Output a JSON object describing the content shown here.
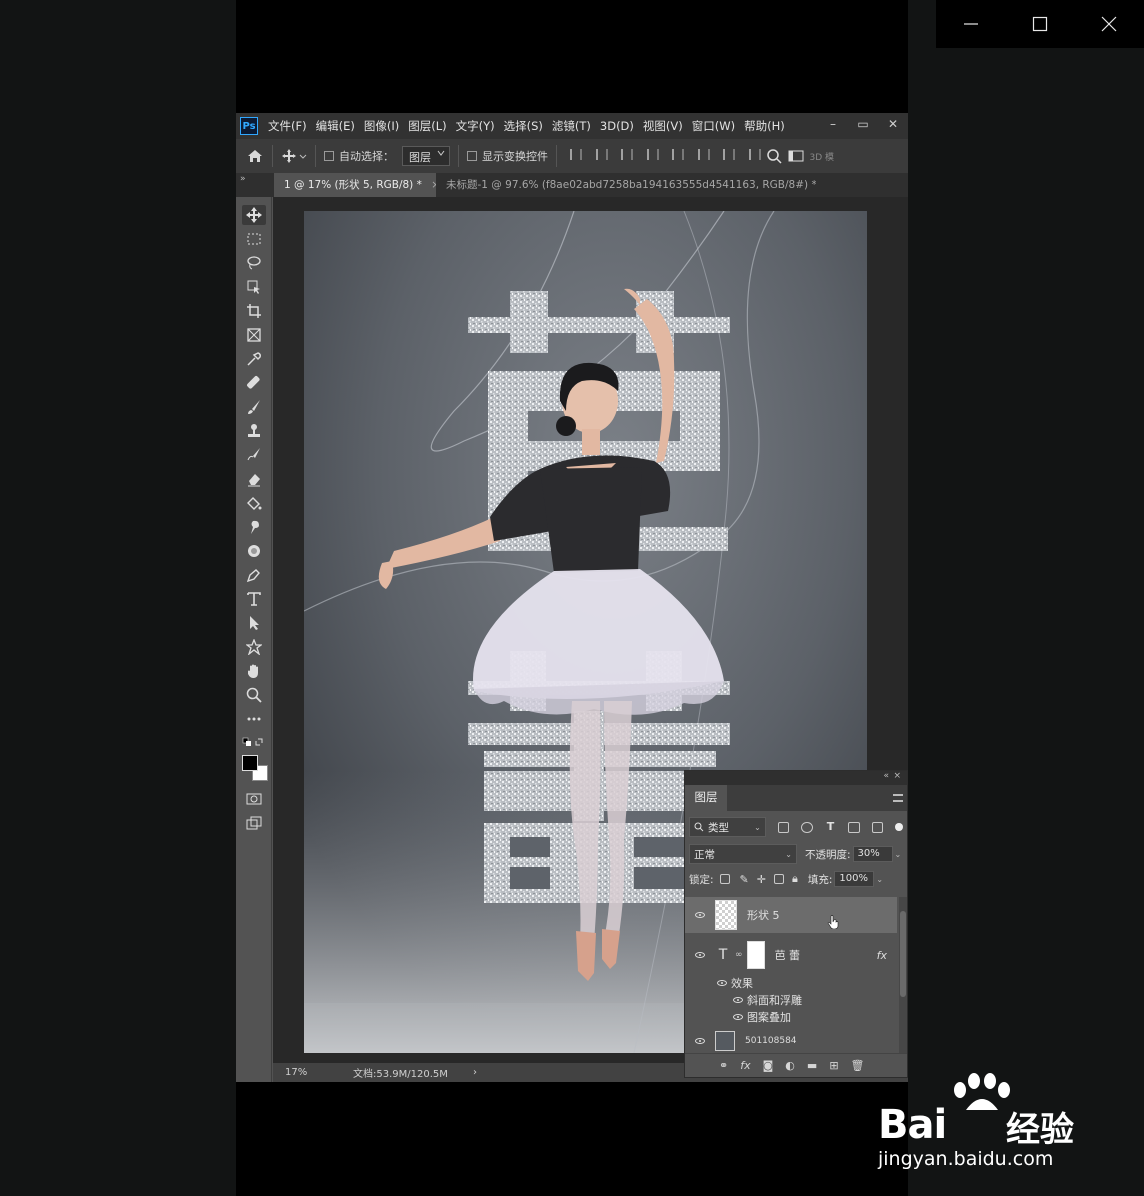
{
  "window": {
    "minimize_icon": "minimize-icon",
    "maximize_icon": "maximize-icon",
    "close_icon": "close-icon"
  },
  "app": {
    "logo": "Ps"
  },
  "menu": [
    "文件(F)",
    "编辑(E)",
    "图像(I)",
    "图层(L)",
    "文字(Y)",
    "选择(S)",
    "滤镜(T)",
    "3D(D)",
    "视图(V)",
    "窗口(W)",
    "帮助(H)"
  ],
  "options": {
    "auto_select_label": "自动选择：",
    "auto_select_value": "图层",
    "show_transform_label": "显示变换控件",
    "mode_3d": "3D 模"
  },
  "tabs": [
    {
      "label": "1 @ 17% (形状 5, RGB/8) *",
      "close": "×"
    },
    {
      "label": "未标题-1 @ 97.6% (f8ae02abd7258ba194163555d4541163, RGB/8#) *",
      "close": "×"
    }
  ],
  "tabs_collapse": "»",
  "canvas": {
    "title_top": "芭",
    "title_bottom": "蕾",
    "colors": {
      "background": "#5f646a",
      "text_texture": "#c9ccd0",
      "leotard": "#2b2b2e",
      "skirt": "#e6e3ee",
      "skin": "#e2b8a2"
    }
  },
  "status": {
    "zoom": "17%",
    "doc": "文档:53.9M/120.5M",
    "arrow": "›"
  },
  "layers_panel": {
    "title": "图层",
    "collapse": "«",
    "close": "×",
    "filter_kind": "类型",
    "blend_mode": "正常",
    "opacity_label": "不透明度:",
    "opacity_value": "30%",
    "lock_label": "锁定:",
    "fill_label": "填充:",
    "fill_value": "100%",
    "layers": [
      {
        "name": "形状 5",
        "selected": true
      },
      {
        "name": "芭 蕾",
        "type": "text",
        "fx": "fx"
      },
      {
        "name": "效果",
        "effect_group": true
      },
      {
        "name": "斜面和浮雕",
        "effect": true
      },
      {
        "name": "图案叠加",
        "effect": true
      },
      {
        "name": "501108584",
        "partial": true
      }
    ],
    "footer": [
      "link-icon",
      "fx",
      "mask-icon",
      "adjustment-icon",
      "folder-icon",
      "new-layer-icon",
      "trash-icon"
    ]
  },
  "watermark": {
    "brand": "Bai",
    "brand_suffix": "经验",
    "url": "jingyan.baidu.com"
  }
}
